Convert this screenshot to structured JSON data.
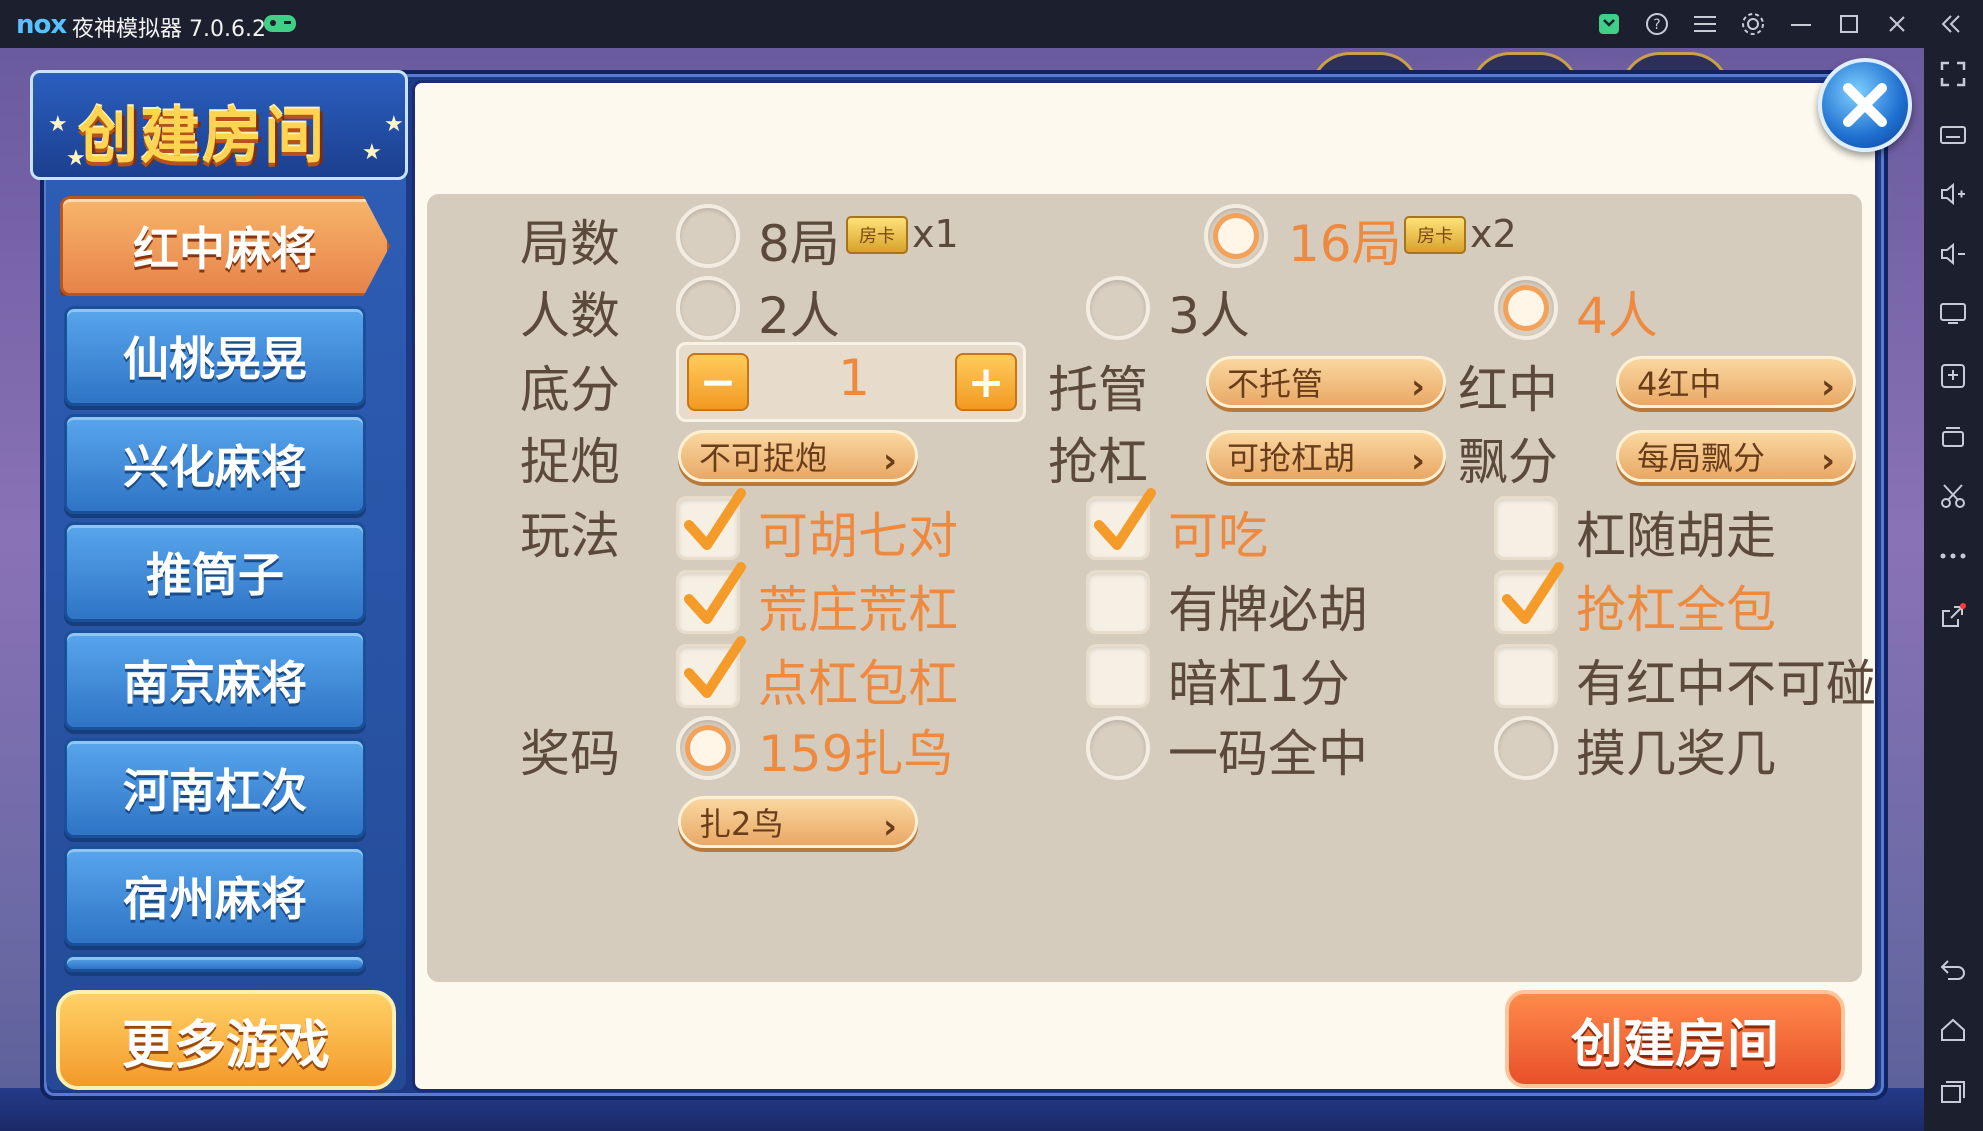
{
  "window": {
    "logo": "nox",
    "title": "夜神模拟器 7.0.6.2",
    "controls": [
      "gamepad-icon",
      "plugin-icon",
      "help-icon",
      "menu-icon",
      "settings-icon",
      "minimize-icon",
      "maximize-icon",
      "close-icon",
      "collapse-icon"
    ]
  },
  "sidebar": {
    "tools": [
      "fullscreen-icon",
      "keyboard-icon",
      "volume-up-icon",
      "volume-down-icon",
      "screen-icon",
      "apk-install-icon",
      "multi-instance-icon",
      "scissors-icon",
      "more-icon",
      "share-icon",
      "back-icon",
      "home-icon",
      "recents-icon"
    ]
  },
  "dialog": {
    "title": "创建房间",
    "games": [
      "红中麻将",
      "仙桃晃晃",
      "兴化麻将",
      "推筒子",
      "南京麻将",
      "河南杠次",
      "宿州麻将"
    ],
    "more_games": "更多游戏",
    "create_button": "创建房间",
    "labels": {
      "rounds": "局数",
      "players": "人数",
      "base": "底分",
      "trust": "托管",
      "hongzhong": "红中",
      "zhuopao": "捉炮",
      "qianggang": "抢杠",
      "piaofen": "飘分",
      "wanfa": "玩法",
      "jiangma": "奖码"
    },
    "rounds": [
      {
        "label": "8局",
        "card": "房卡",
        "mult": "x1",
        "selected": false
      },
      {
        "label": "16局",
        "card": "房卡",
        "mult": "x2",
        "selected": true
      }
    ],
    "players": [
      {
        "label": "2人",
        "selected": false
      },
      {
        "label": "3人",
        "selected": false
      },
      {
        "label": "4人",
        "selected": true
      }
    ],
    "base_score": {
      "value": "1",
      "minus": "−",
      "plus": "+"
    },
    "dropdowns": {
      "trust": "不托管",
      "hongzhong": "4红中",
      "zhuopao": "不可捉炮",
      "qianggang": "可抢杠胡",
      "piaofen": "每局飘分",
      "zhaniao": "扎2鸟"
    },
    "wanfa": [
      {
        "label": "可胡七对",
        "checked": true
      },
      {
        "label": "可吃",
        "checked": true
      },
      {
        "label": "杠随胡走",
        "checked": false
      },
      {
        "label": "荒庄荒杠",
        "checked": true
      },
      {
        "label": "有牌必胡",
        "checked": false
      },
      {
        "label": "抢杠全包",
        "checked": true
      },
      {
        "label": "点杠包杠",
        "checked": true
      },
      {
        "label": "暗杠1分",
        "checked": false
      },
      {
        "label": "有红中不可碰",
        "checked": false
      }
    ],
    "jiangma": [
      {
        "label": "159扎鸟",
        "selected": true
      },
      {
        "label": "一码全中",
        "selected": false
      },
      {
        "label": "摸几奖几",
        "selected": false
      }
    ]
  },
  "colors": {
    "accent": "#ee8a40",
    "text": "#5b4a3c",
    "panel": "#d6ccbd"
  }
}
